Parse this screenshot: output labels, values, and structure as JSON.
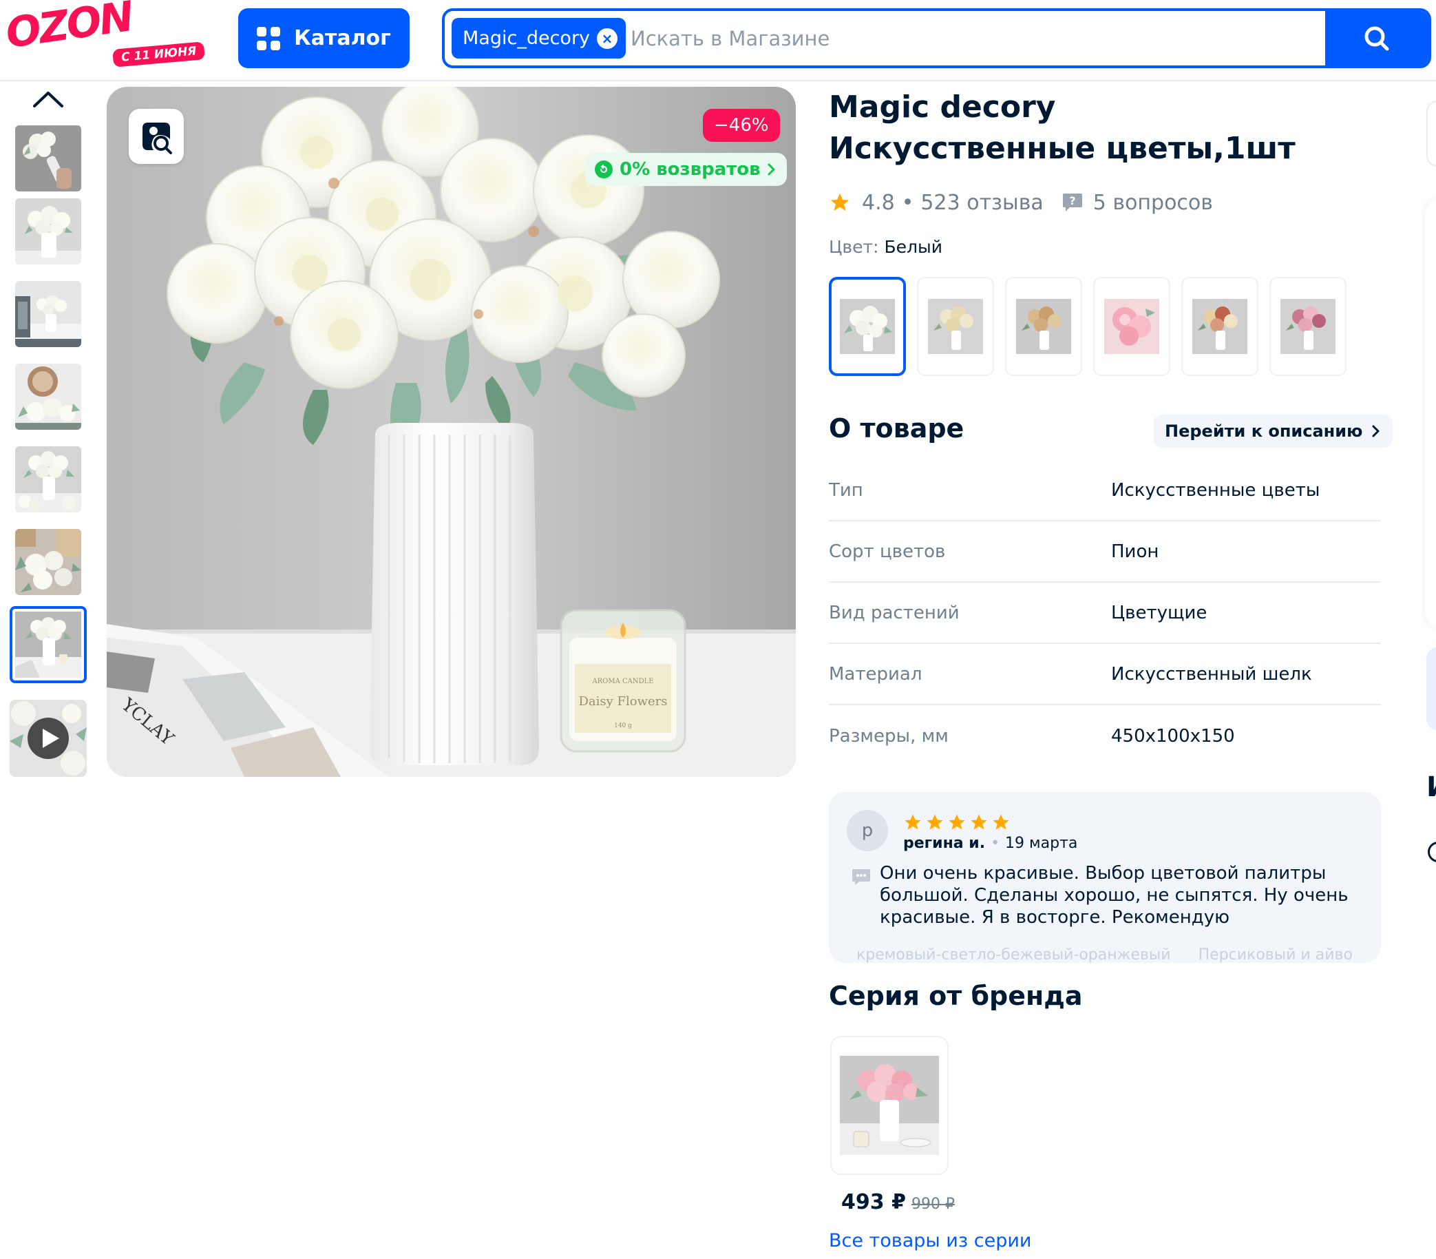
{
  "header": {
    "logo_text": "OZON",
    "logo_sub": "С 11 ИЮНЯ",
    "catalog_label": "Каталог",
    "search": {
      "chip_label": "Magic_decory",
      "placeholder": "Искать в Магазине"
    }
  },
  "gallery": {
    "discount": "−46%",
    "returns_label": "0% возвратов",
    "thumbnails_count": 7
  },
  "product": {
    "title": "Magic decory Искусственные цветы,1шт",
    "rating": "4.8",
    "reviews": "523 отзыва",
    "questions": "5 вопросов",
    "color_label": "Цвет:",
    "color_value": "Белый"
  },
  "about": {
    "title": "О товаре",
    "link_label": "Перейти к описанию",
    "specs": [
      {
        "key": "Тип",
        "value": "Искусственные цветы"
      },
      {
        "key": "Сорт цветов",
        "value": "Пион"
      },
      {
        "key": "Вид растений",
        "value": "Цветущие"
      },
      {
        "key": "Материал",
        "value": "Искусственный шелк"
      },
      {
        "key": "Размеры, мм",
        "value": "450x100x150"
      }
    ]
  },
  "review": {
    "avatar_letter": "р",
    "author": "регина и.",
    "date": "19 марта",
    "text": "Они очень красивые. Выбор цветовой палитры большой. Сделаны хорошо, не сыпятся. Ну очень красивые. Я в восторге. Рекомендую",
    "faded_tags": [
      "кремовый-светло-бежевый-оранжевый",
      "Персиковый и айво"
    ]
  },
  "series": {
    "title": "Серия от бренда",
    "price": "493 ₽",
    "old_price": "990 ₽",
    "all_link": "Все товары из серии"
  },
  "edge": {
    "letter": "И"
  },
  "colors": {
    "brand_blue": "#005bff",
    "brand_pink": "#f91155",
    "green": "#10c44c",
    "text": "#001a34",
    "muted": "#707f8d"
  }
}
